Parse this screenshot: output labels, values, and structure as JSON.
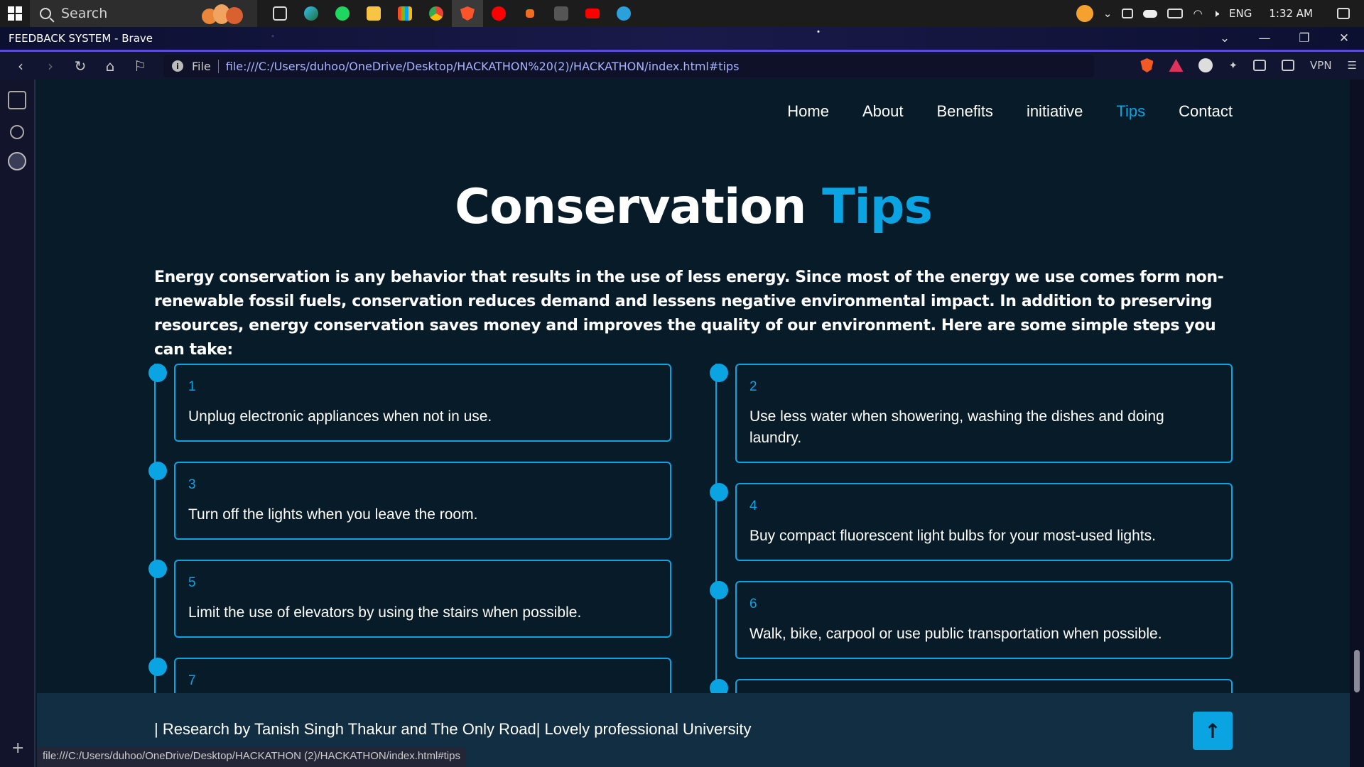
{
  "taskbar": {
    "search_label": "Search",
    "tray_lang": "ENG",
    "tray_time": "1:32 AM",
    "apps": [
      "task-view",
      "edge",
      "spotify",
      "file-explorer",
      "store",
      "chrome",
      "brave",
      "youtube-music",
      "app-orange",
      "app-l",
      "youtube",
      "telegram"
    ]
  },
  "browser": {
    "window_title": "FEEDBACK SYSTEM - Brave",
    "url_prefix": "File",
    "url": "file:///C:/Users/duhoo/OneDrive/Desktop/HACKATHON%20(2)/HACKATHON/index.html#tips",
    "vpn_label": "VPN",
    "status_url": "file:///C:/Users/duhoo/OneDrive/Desktop/HACKATHON (2)/HACKATHON/index.html#tips",
    "accent": "#5b4bd6"
  },
  "site": {
    "accent": "#0ba4e3",
    "background": "#081b29",
    "nav": [
      "Home",
      "About",
      "Benefits",
      "initiative",
      "Tips",
      "Contact"
    ],
    "active_nav": "Tips",
    "heading_main": "Conservation",
    "heading_highlight": "Tips",
    "intro": "Energy conservation is any behavior that results in the use of less energy. Since most of the energy we use comes form non-renewable fossil fuels, conservation reduces demand and lessens negative environmental impact. In addition to preserving resources, energy conservation saves money and improves the quality of our environment. Here are some simple steps you can take:",
    "tips_left": [
      {
        "num": "1",
        "text": "Unplug electronic appliances when not in use."
      },
      {
        "num": "3",
        "text": "Turn off the lights when you leave the room."
      },
      {
        "num": "5",
        "text": "Limit the use of elevators by using the stairs when possible."
      },
      {
        "num": "7",
        "text": ""
      }
    ],
    "tips_right": [
      {
        "num": "2",
        "text": "Use less water when showering, washing the dishes and doing laundry."
      },
      {
        "num": "4",
        "text": "Buy compact fluorescent light bulbs for your most-used lights."
      },
      {
        "num": "6",
        "text": "Walk, bike, carpool or use public transportation when possible."
      },
      {
        "num": "",
        "text": ""
      }
    ],
    "footer_credit": "| Research by Tanish Singh Thakur and The Only Road| Lovely professional University",
    "back_to_top": "↑"
  }
}
